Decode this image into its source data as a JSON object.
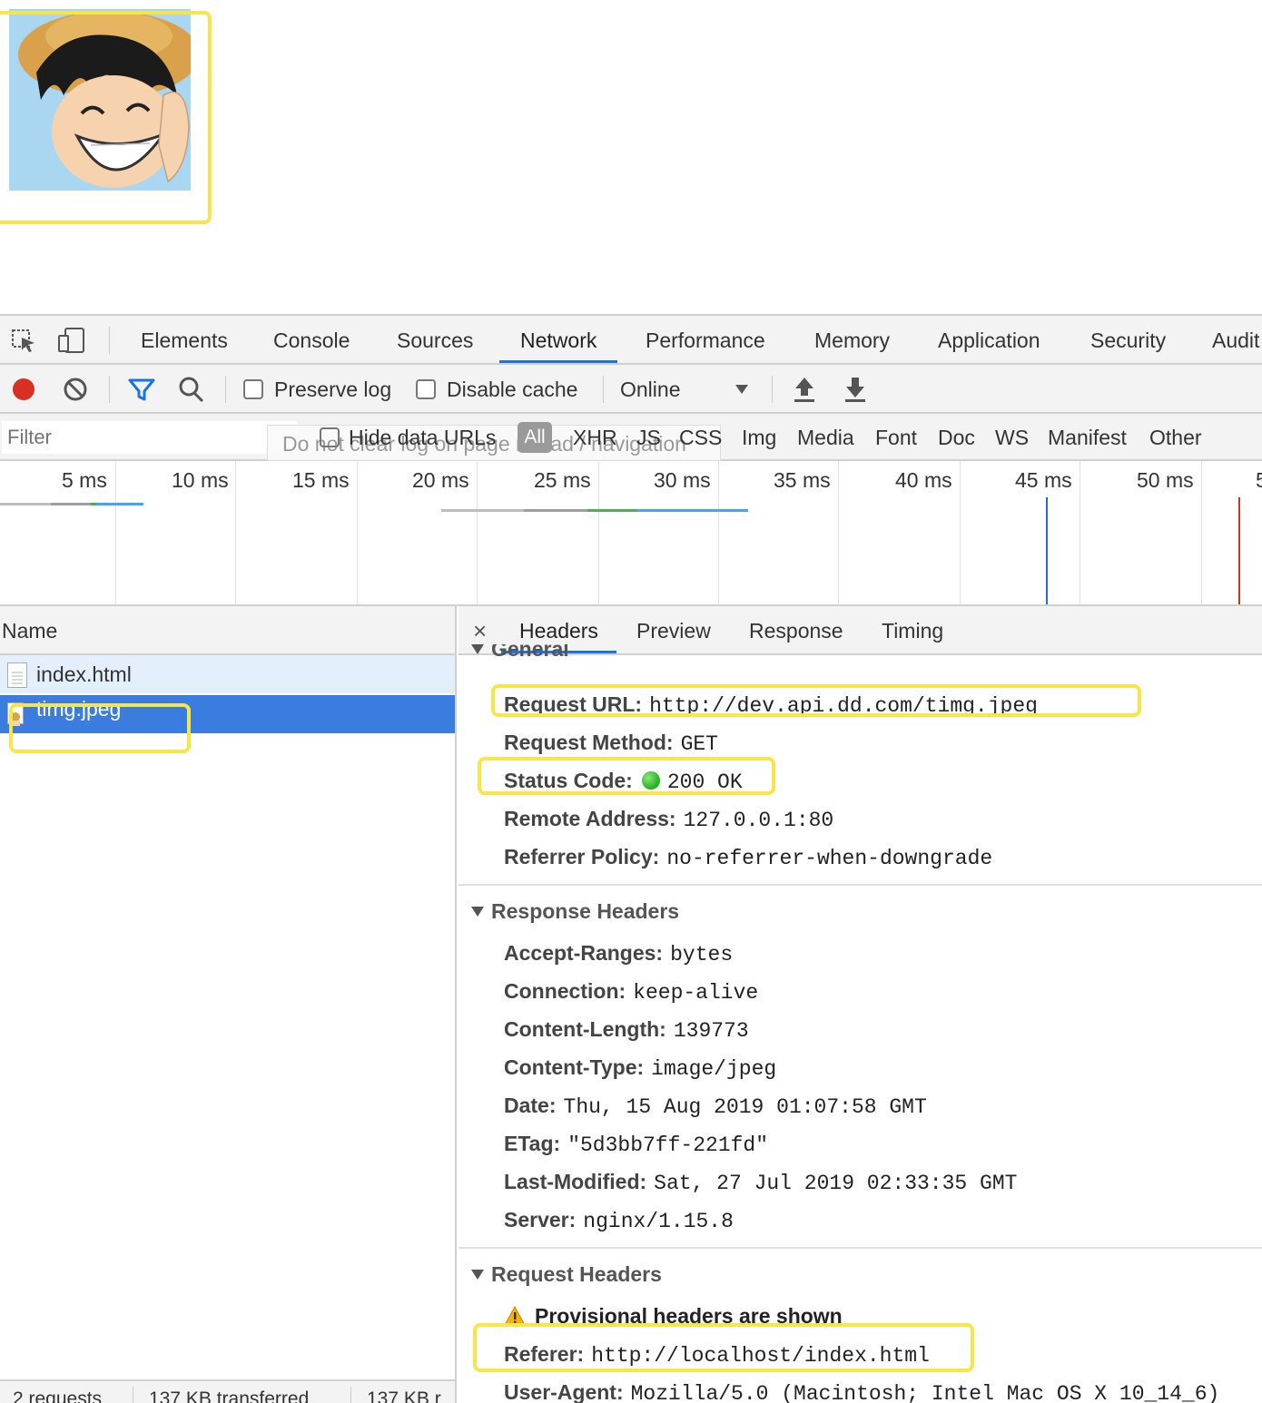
{
  "devtools": {
    "main_tabs": [
      "Elements",
      "Console",
      "Sources",
      "Network",
      "Performance",
      "Memory",
      "Application",
      "Security",
      "Audit"
    ],
    "active_tab": "Network",
    "toolbar": {
      "preserve_log": "Preserve log",
      "disable_cache": "Disable cache",
      "throttle": "Online"
    },
    "filter": {
      "placeholder": "Filter",
      "tooltip": "Do not clear log on page reload / navigation",
      "hide_data_urls": "Hide data URLs",
      "types": [
        "All",
        "XHR",
        "JS",
        "CSS",
        "Img",
        "Media",
        "Font",
        "Doc",
        "WS",
        "Manifest",
        "Other"
      ]
    },
    "timeline": {
      "ticks": [
        "5 ms",
        "10 ms",
        "15 ms",
        "20 ms",
        "25 ms",
        "30 ms",
        "35 ms",
        "40 ms",
        "45 ms",
        "50 ms",
        "5"
      ]
    },
    "requests": {
      "column_name": "Name",
      "items": [
        "index.html",
        "timg.jpeg"
      ],
      "selected": "timg.jpeg",
      "status_summary": [
        "2 requests",
        "137 KB transferred",
        "137 KB r"
      ]
    },
    "detail": {
      "close": "×",
      "tabs": [
        "Headers",
        "Preview",
        "Response",
        "Timing"
      ],
      "active_tab": "Headers",
      "general": {
        "title": "General",
        "rows": [
          {
            "key": "Request URL:",
            "value": "http://dev.api.dd.com/timg.jpeg"
          },
          {
            "key": "Request Method:",
            "value": "GET"
          },
          {
            "key": "Status Code:",
            "value": "200 OK"
          },
          {
            "key": "Remote Address:",
            "value": "127.0.0.1:80"
          },
          {
            "key": "Referrer Policy:",
            "value": "no-referrer-when-downgrade"
          }
        ]
      },
      "response_headers": {
        "title": "Response Headers",
        "rows": [
          {
            "key": "Accept-Ranges:",
            "value": "bytes"
          },
          {
            "key": "Connection:",
            "value": "keep-alive"
          },
          {
            "key": "Content-Length:",
            "value": "139773"
          },
          {
            "key": "Content-Type:",
            "value": "image/jpeg"
          },
          {
            "key": "Date:",
            "value": "Thu, 15 Aug 2019 01:07:58 GMT"
          },
          {
            "key": "ETag:",
            "value": "\"5d3bb7ff-221fd\""
          },
          {
            "key": "Last-Modified:",
            "value": "Sat, 27 Jul 2019 02:33:35 GMT"
          },
          {
            "key": "Server:",
            "value": "nginx/1.15.8"
          }
        ]
      },
      "request_headers": {
        "title": "Request Headers",
        "warning": "Provisional headers are shown",
        "rows": [
          {
            "key": "Referer:",
            "value": "http://localhost/index.html"
          },
          {
            "key": "User-Agent:",
            "value": "Mozilla/5.0 (Macintosh; Intel Mac OS X 10_14_6)"
          }
        ]
      }
    }
  },
  "colors": {
    "highlight": "#f7e64a",
    "accent": "#1a73e8",
    "selected_row": "#3a7ddf",
    "hover_row": "#e3effd",
    "record": "#d93025"
  }
}
